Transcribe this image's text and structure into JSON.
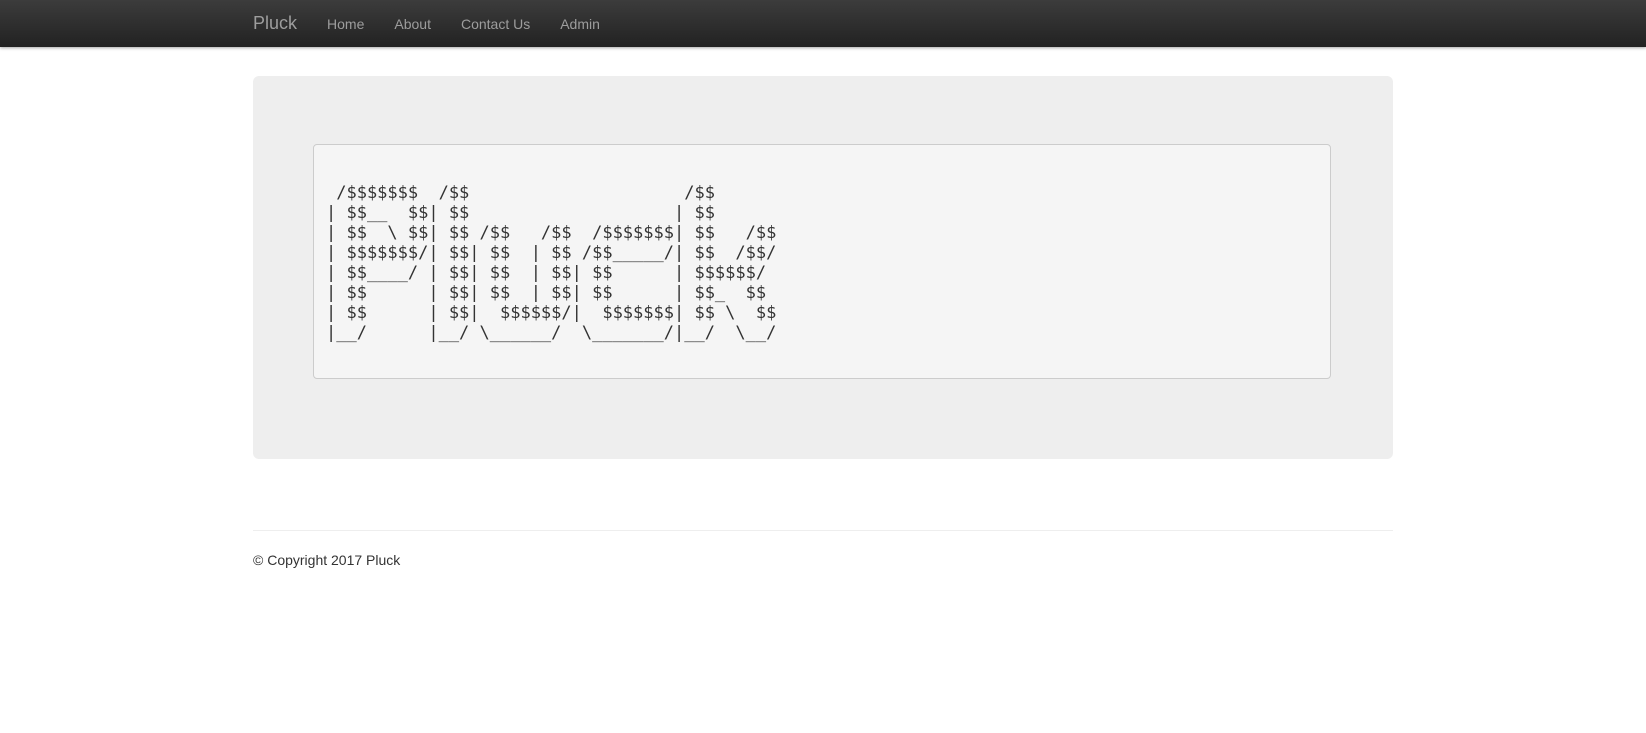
{
  "navbar": {
    "brand": "Pluck",
    "links": [
      "Home",
      "About",
      "Contact Us",
      "Admin"
    ]
  },
  "banner": {
    "ascii_art": " /$$$$$$$  /$$                     /$$      \n| $$__  $$| $$                    | $$      \n| $$  \\ $$| $$ /$$   /$$  /$$$$$$$| $$   /$$\n| $$$$$$$/| $$| $$  | $$ /$$_____/| $$  /$$/\n| $$____/ | $$| $$  | $$| $$      | $$$$$$/ \n| $$      | $$| $$  | $$| $$      | $$_  $$ \n| $$      | $$|  $$$$$$/|  $$$$$$$| $$ \\  $$\n|__/      |__/ \\______/  \\_______/|__/  \\__/"
  },
  "footer": {
    "copyright": "© Copyright 2017 Pluck"
  },
  "colors": {
    "navbar_top": "#3c3c3c",
    "navbar_bottom": "#222222",
    "nav_text": "#9d9d9d",
    "jumbotron_bg": "#eeeeee",
    "pre_bg": "#f5f5f5"
  }
}
